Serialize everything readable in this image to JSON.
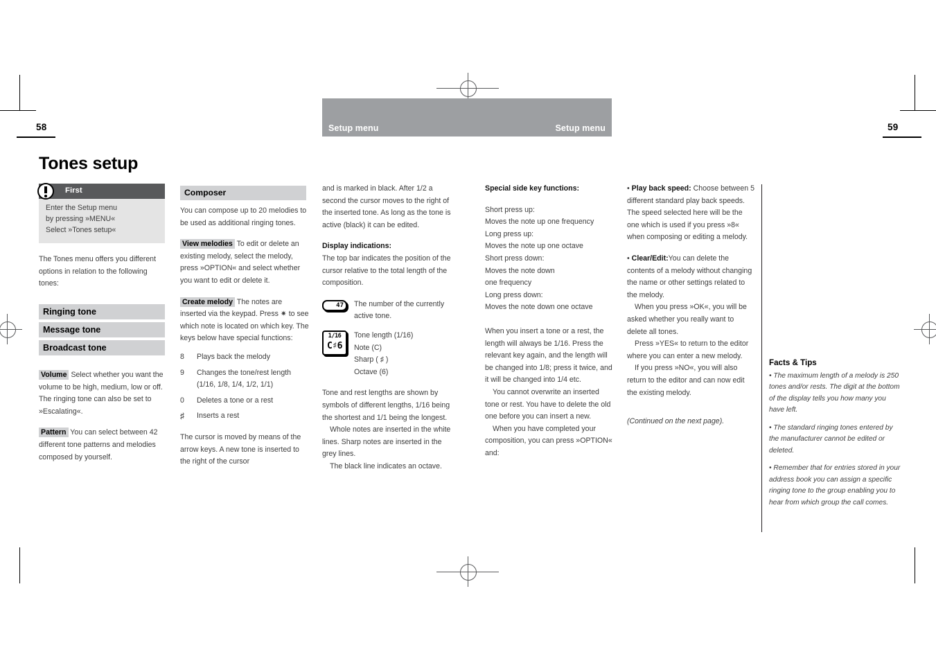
{
  "page": {
    "left_folio": "58",
    "right_folio": "59",
    "running_head_left": "Setup menu",
    "running_head_right": "Setup menu",
    "band_color": "#9d9fa2",
    "bar_color": "#d0d1d3",
    "callout_head_color": "#58595b"
  },
  "title": "Tones setup",
  "callout": {
    "icon": "exclamation-circle-icon",
    "title": "First",
    "lines": [
      "Enter the Setup menu",
      "by pressing »MENU«",
      "Select »Tones setup«"
    ]
  },
  "column1": {
    "intro": "The Tones menu offers you different options in relation to the following tones:",
    "menu_items": [
      "Ringing tone",
      "Message tone",
      "Broadcast tone"
    ],
    "volume": {
      "keyword": "Volume",
      "text": "Select whether you want the volume to be high, medium, low or off. The ringing tone can also be set to »Escalating«."
    },
    "pattern": {
      "keyword": "Pattern",
      "text": "You can select between 42 different tone patterns and melodies composed by yourself."
    }
  },
  "column2": {
    "section_title": "Composer",
    "intro": "You can compose up to 20 melodies to be used as additional ringing tones.",
    "view_melodies": {
      "keyword": "View melodies",
      "text": "To edit or delete an existing melody, select the melody, press »OPTION« and select whether you want to edit or delete it."
    },
    "create_melody": {
      "keyword": "Create melody",
      "text_before": "The notes are inserted via the keypad. Press",
      "star_symbol": "✷",
      "text_after": "to see which note is located on which key. The keys below have special functions:"
    },
    "keys": [
      {
        "key": "8",
        "desc": "Plays back the melody"
      },
      {
        "key": "9",
        "desc": "Changes the tone/rest length (1/16, 1/8, 1/4, 1/2, 1/1)"
      },
      {
        "key": "0",
        "desc": "Deletes a tone or a rest"
      },
      {
        "key": "♯",
        "desc": "Inserts a rest"
      }
    ],
    "closing": "The cursor is moved by means of the arrow keys. A new tone is inserted to the right of the cursor"
  },
  "column3": {
    "continuation": "and is marked in black. After 1/2 a second the cursor moves to the right of the inserted tone. As long as the tone is active (black) it can be edited.",
    "display_heading": "Display indications:",
    "display_intro": "The top bar indicates the position of the cursor relative to the total length of the composition.",
    "lcd_number": {
      "glyph": "47",
      "caption": "The number of the currently active tone."
    },
    "lcd_note": {
      "glyph_line1": "1/16",
      "glyph_line2": "C♯6",
      "caption_lines": [
        "Tone length (1/16)",
        "Note (C)",
        "Sharp ( ♯ )",
        "Octave (6)"
      ]
    },
    "lengths_text": "Tone and rest lengths are shown by symbols of different lengths, 1/16 being the shortest and 1/1 being the longest.",
    "whole_notes_text": "Whole notes are inserted in the white lines. Sharp notes are inserted in the grey lines.",
    "black_line_text": "The black line indicates an octave."
  },
  "column4": {
    "heading": "Special side key functions:",
    "side_keys": [
      "Short press up:",
      "Moves the note up one frequency",
      "Long press up:",
      "Moves the note up one octave",
      "Short press down:",
      "Moves the note down",
      "one frequency",
      "Long press down:",
      "Moves the note down one octave"
    ],
    "para1": "When you insert a tone or a rest, the length will always be 1/16. Press the relevant key again, and the length will be changed into 1/8; press it twice, and it will be changed into 1/4 etc.",
    "para2": "You cannot overwrite an inserted tone or rest. You have to delete the old one before you can insert a new.",
    "para3": "When you have completed your composition, you can press »OPTION« and:"
  },
  "column5": {
    "playback": {
      "bullet": "•",
      "keyword": "Play back speed:",
      "text": "Choose between 5 different standard play back speeds. The speed selected here will be the one which is used if you press »8« when composing or editing a melody."
    },
    "clear_edit": {
      "bullet": "•",
      "keyword": "Clear/Edit:",
      "text": "You can delete the contents of a melody without changing the name or other settings related to the melody."
    },
    "para1": "When you press »OK«, you will be asked whether you really want to delete all tones.",
    "para2": "Press »YES« to return to the editor where you can enter a new melody.",
    "para3": "If you press »NO«, you will also return to the editor and can now edit the existing melody.",
    "continued": "(Continued on the next page)."
  },
  "facts": {
    "heading": "Facts & Tips",
    "items": [
      "• The maximum length of a melody is 250 tones and/or rests. The digit at the bottom of the display tells you how many you have left.",
      "• The standard ringing tones entered by the manufacturer cannot be edited or deleted.",
      "• Remember that for entries stored in your address book you can assign a specific ringing tone to the group enabling you to hear from which group the call comes."
    ]
  }
}
